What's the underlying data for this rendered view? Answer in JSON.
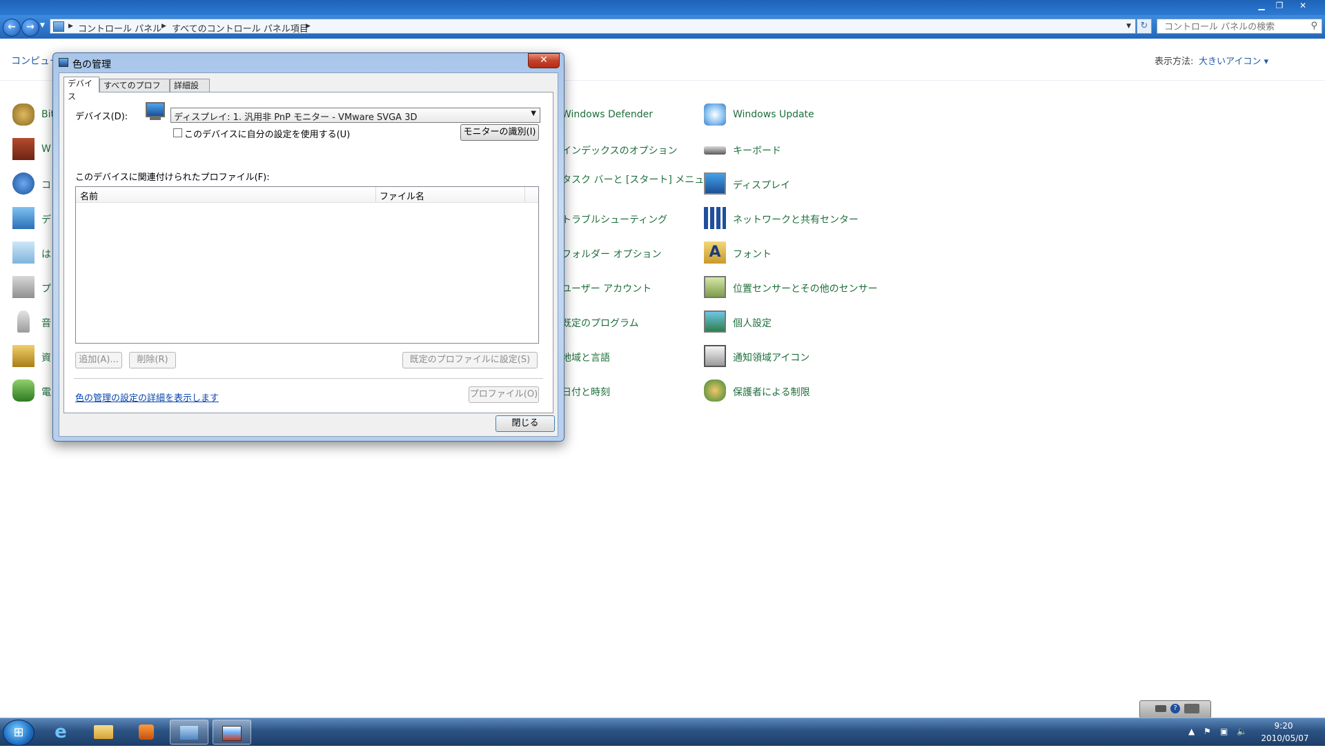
{
  "breadcrumb": {
    "items": [
      "コントロール パネル",
      "すべてのコントロール パネル項目"
    ]
  },
  "search": {
    "placeholder": "コントロール パネルの検索"
  },
  "content": {
    "header_text": "コンピュー",
    "view_by_label": "表示方法:",
    "view_by_value": "大きいアイコン ▾"
  },
  "control_panel_items": {
    "col1": [
      "Bit",
      "W",
      "コ",
      "デ",
      "は",
      "プ",
      "音",
      "資",
      "電"
    ],
    "col2": [
      "Windows Defender",
      "インデックスのオプション",
      "タスク バーと [スタート] メニュー",
      "トラブルシューティング",
      "フォルダー オプション",
      "ユーザー アカウント",
      "既定のプログラム",
      "地域と言語",
      "日付と時刻"
    ],
    "col3": [
      "Windows Update",
      "キーボード",
      "ディスプレイ",
      "ネットワークと共有センター",
      "フォント",
      "位置センサーとその他のセンサー",
      "個人設定",
      "通知領域アイコン",
      "保護者による制限"
    ]
  },
  "dialog": {
    "title": "色の管理",
    "close_glyph": "✕",
    "tabs": [
      "デバイス",
      "すべてのプロファイル",
      "詳細設定"
    ],
    "device_label": "デバイス(D):",
    "device_value": "ディスプレイ: 1. 汎用非 PnP モニター - VMware SVGA 3D",
    "use_my_settings": "このデバイスに自分の設定を使用する(U)",
    "identify_button": "モニターの識別(I)",
    "profiles_label": "このデバイスに関連付けられたプロファイル(F):",
    "columns": [
      "名前",
      "ファイル名"
    ],
    "add_button": "追加(A)...",
    "remove_button": "削除(R)",
    "set_default_button": "既定のプロファイルに設定(S)",
    "profiles_button": "プロファイル(O)",
    "advanced_link": "色の管理の設定の詳細を表示します",
    "close_button": "閉じる"
  },
  "taskbar": {
    "time": "9:20",
    "date": "2010/05/07"
  },
  "colors": {
    "link": "#0645ad",
    "item_text": "#1e6f3b",
    "title_blue": "#2c7ad3",
    "close_red": "#c4412a"
  }
}
